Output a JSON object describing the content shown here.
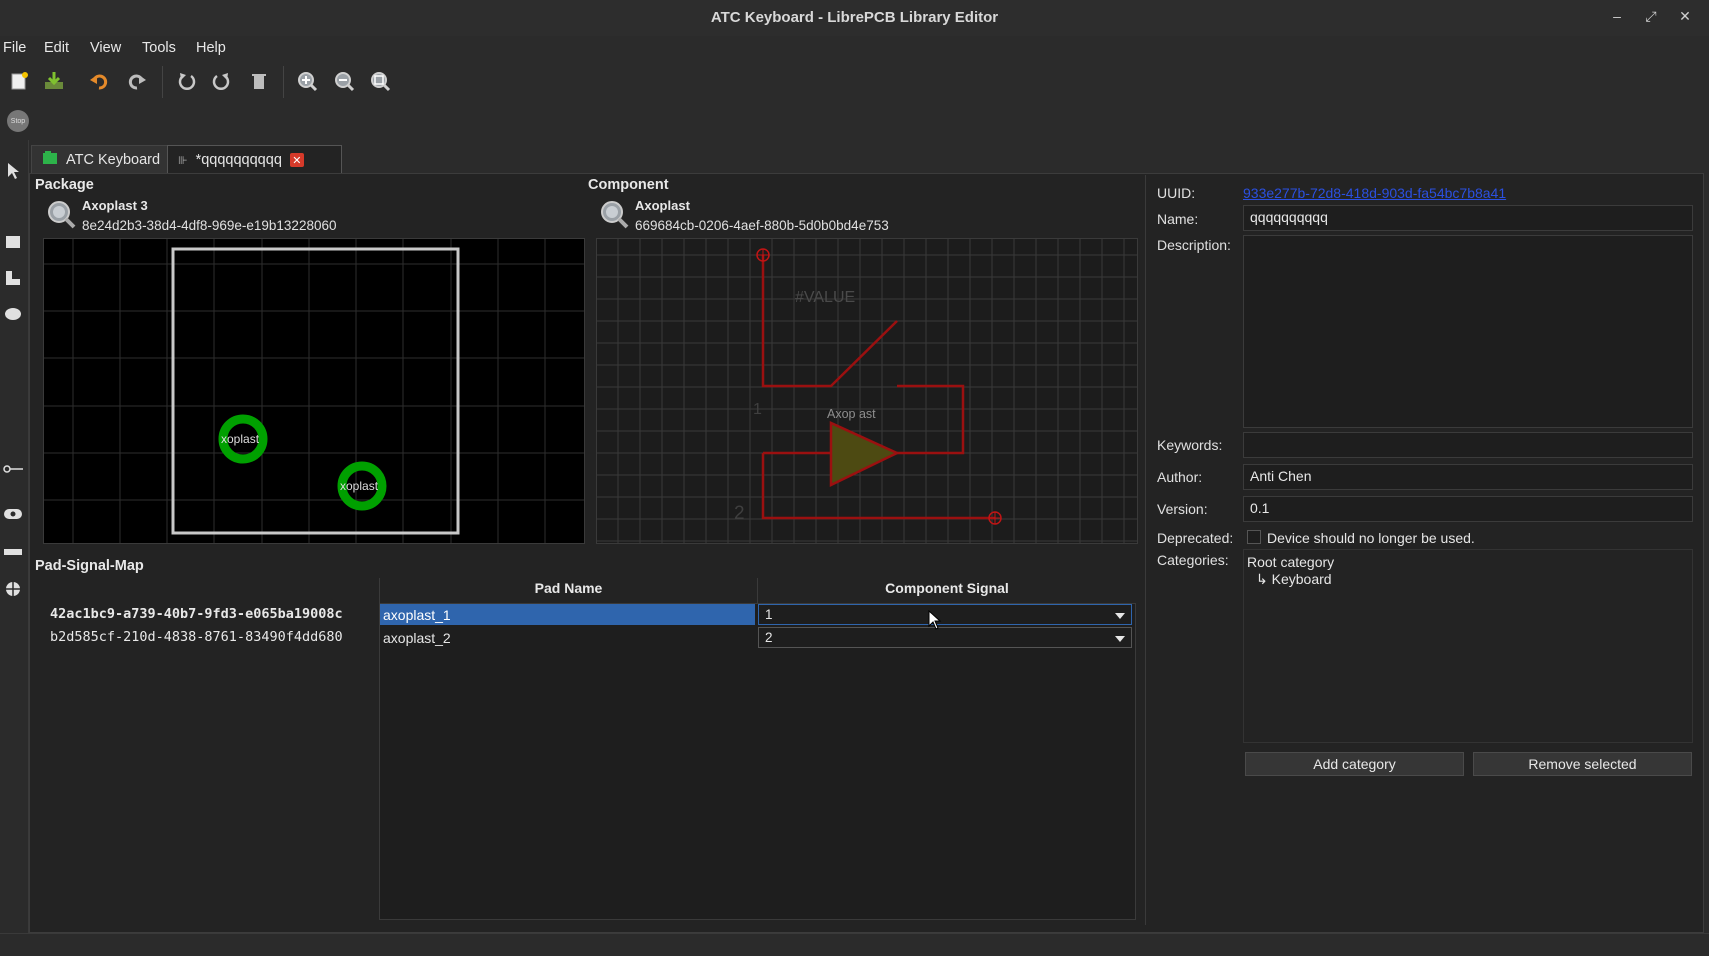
{
  "window": {
    "title": "ATC Keyboard - LibrePCB Library Editor",
    "controls": [
      "minimize",
      "maximize",
      "close"
    ]
  },
  "menu": [
    "File",
    "Edit",
    "View",
    "Tools",
    "Help"
  ],
  "toolbar": {
    "icons": [
      "new-icon",
      "save-icon",
      "undo-icon",
      "redo-icon",
      "rotate-ccw-icon",
      "rotate-cw-icon",
      "delete-icon",
      "zoom-in-icon",
      "zoom-out-icon",
      "zoom-fit-icon"
    ],
    "stop_label": "Stop"
  },
  "tabs": [
    {
      "label": "ATC Keyboard",
      "active": false
    },
    {
      "label": "*qqqqqqqqqq",
      "active": true
    }
  ],
  "package": {
    "section": "Package",
    "name": "Axoplast 3",
    "uuid": "8e24d2b3-38d4-4df8-969e-e19b13228060",
    "pad_labels": [
      "xoplast",
      "xoplast"
    ]
  },
  "component": {
    "section": "Component",
    "name": "Axoplast",
    "uuid": "669684cb-0206-4aef-880b-5d0b0bd4e753",
    "value_text": "#VALUE",
    "name_text": "Axop ast",
    "pin_numbers": [
      "1",
      "2"
    ]
  },
  "properties": {
    "uuid_label": "UUID:",
    "uuid_value": "933e277b-72d8-418d-903d-fa54bc7b8a41",
    "name_label": "Name:",
    "name_value": "qqqqqqqqqq",
    "description_label": "Description:",
    "description_value": "",
    "keywords_label": "Keywords:",
    "keywords_value": "",
    "author_label": "Author:",
    "author_value": "Anti Chen",
    "version_label": "Version:",
    "version_value": "0.1",
    "deprecated_label": "Deprecated:",
    "deprecated_text": "Device should no longer be used.",
    "deprecated_checked": false,
    "categories_label": "Categories:",
    "categories": [
      "Root category",
      "↳ Keyboard"
    ],
    "add_category": "Add category",
    "remove_selected": "Remove selected"
  },
  "pad_signal_map": {
    "title": "Pad-Signal-Map",
    "columns": [
      "Pad Name",
      "Component Signal"
    ],
    "rows": [
      {
        "uuid": "42ac1bc9-a739-40b7-9fd3-e065ba19008c",
        "pad": "axoplast_1",
        "signal": "1",
        "selected": true
      },
      {
        "uuid": "b2d585cf-210d-4838-8761-83490f4dd680",
        "pad": "axoplast_2",
        "signal": "2",
        "selected": false
      }
    ]
  },
  "colors": {
    "accent_selection": "#2f65ad",
    "pad_green": "#00a000",
    "symbol_red": "#9b1010",
    "link_blue": "#2b50e0"
  }
}
